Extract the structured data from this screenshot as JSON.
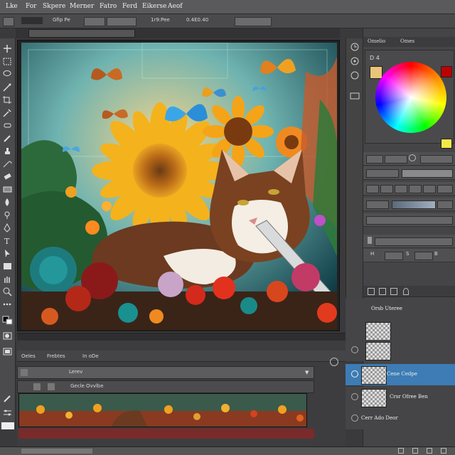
{
  "menu": [
    "Lke",
    "For",
    "Skpere",
    "Merner",
    "Fatro",
    "Ferd",
    "Eikerse",
    "Aeof"
  ],
  "options_bar": {
    "label": "Gfip Pe",
    "coords": "1r9:Pee",
    "zoom": "0.4E0.40"
  },
  "document_tab": "",
  "color_panel": {
    "tab_a": "Omelio",
    "tab_b": "Omes",
    "indicator": "D 4"
  },
  "adjust_rows": [
    {
      "label": "H",
      "value": "0"
    },
    {
      "label": "S",
      "value": "0"
    },
    {
      "label": "B",
      "value": "0"
    }
  ],
  "layers": [
    {
      "name": "Orsb Uteree",
      "selected": false
    },
    {
      "name": "Cene Cedpe",
      "selected": true
    },
    {
      "name": "Crsr Ofree Ben",
      "selected": false
    },
    {
      "name": "Cerr Ado Deor",
      "selected": false
    }
  ],
  "timeline": {
    "header": [
      "Oeles",
      "Frebtes",
      "In oDe"
    ],
    "track_a": "Lerev",
    "track_b": "Gecle Ovvlbe"
  },
  "colors": {
    "accent_selected": "#3d7cb4",
    "swatch_fg": "#c00000",
    "swatch_bg": "#f4e94a"
  }
}
